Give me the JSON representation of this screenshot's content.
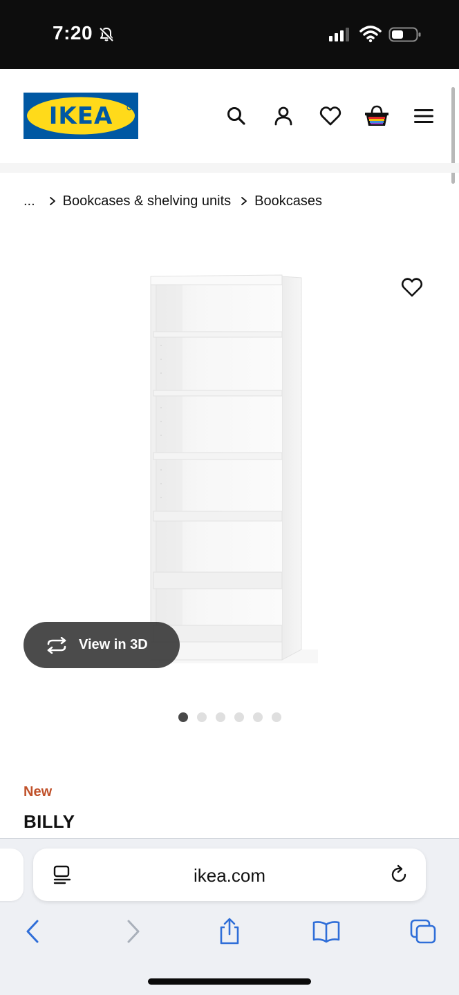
{
  "status_bar": {
    "time": "7:20"
  },
  "brand": {
    "logo_text": "IKEA",
    "colors": {
      "blue": "#0058a3",
      "yellow": "#ffda1a",
      "badge_orange": "#c0512a"
    }
  },
  "header": {
    "icons": [
      "search-icon",
      "account-icon",
      "heart-icon",
      "basket-icon",
      "menu-icon"
    ]
  },
  "breadcrumb": {
    "items": [
      "...",
      "Bookcases & shelving units",
      "Bookcases"
    ]
  },
  "product": {
    "view_3d_label": "View in 3D",
    "carousel": {
      "total": 6,
      "active_index": 0
    },
    "badge": "New",
    "name": "BILLY"
  },
  "browser": {
    "url": "ikea.com",
    "toolbar_icons": [
      "back-icon",
      "forward-icon",
      "share-icon",
      "bookmarks-icon",
      "tabs-icon"
    ]
  }
}
